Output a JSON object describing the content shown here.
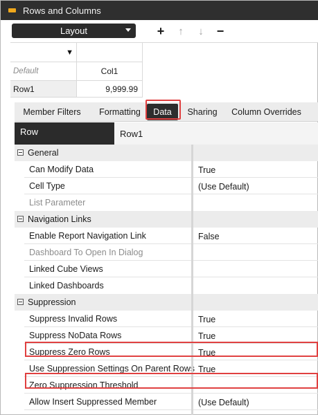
{
  "window": {
    "title": "Rows and Columns"
  },
  "toolbar": {
    "layout_label": "Layout",
    "icons": [
      "plus-icon",
      "arrow-up-icon",
      "arrow-down-icon",
      "minus-icon"
    ],
    "plus_glyph": "+",
    "up_glyph": "↑",
    "down_glyph": "↓",
    "minus_glyph": "−"
  },
  "grid": {
    "filter_glyph": "▼",
    "default_label": "Default",
    "column_header": "Col1",
    "row_label": "Row1",
    "cell_value": "9,999.99"
  },
  "tabs": [
    {
      "label": "Member Filters",
      "active": false
    },
    {
      "label": "Formatting",
      "active": false
    },
    {
      "label": "Data",
      "active": true
    },
    {
      "label": "Sharing",
      "active": false
    },
    {
      "label": "Column Overrides",
      "active": false
    }
  ],
  "row_header": {
    "label": "Row",
    "value": "Row1"
  },
  "properties": {
    "general": {
      "title": "General",
      "items": [
        {
          "name": "Can Modify Data",
          "value": "True",
          "disabled": false
        },
        {
          "name": "Cell Type",
          "value": "(Use Default)",
          "disabled": false
        },
        {
          "name": "List Parameter",
          "value": "",
          "disabled": true
        }
      ]
    },
    "navigation": {
      "title": "Navigation Links",
      "items": [
        {
          "name": "Enable Report Navigation Link",
          "value": "False",
          "disabled": false
        },
        {
          "name": "Dashboard To Open In Dialog",
          "value": "",
          "disabled": true
        },
        {
          "name": "Linked Cube Views",
          "value": "",
          "disabled": false
        },
        {
          "name": "Linked Dashboards",
          "value": "",
          "disabled": false
        }
      ]
    },
    "suppression": {
      "title": "Suppression",
      "items": [
        {
          "name": "Suppress Invalid Rows",
          "value": "True",
          "disabled": false
        },
        {
          "name": "Suppress NoData Rows",
          "value": "True",
          "disabled": false
        },
        {
          "name": "Suppress Zero Rows",
          "value": "True",
          "disabled": false,
          "highlighted": true
        },
        {
          "name": "Use Suppression Settings On Parent Rows",
          "value": "True",
          "disabled": false
        },
        {
          "name": "Zero Suppression Threshold",
          "value": "",
          "disabled": false,
          "highlighted": true
        },
        {
          "name": "Allow Insert Suppressed Member",
          "value": "(Use Default)",
          "disabled": false
        }
      ]
    }
  },
  "colors": {
    "highlight": "#e04040",
    "dark": "#2b2b2b",
    "accent": "#f0a81c"
  }
}
